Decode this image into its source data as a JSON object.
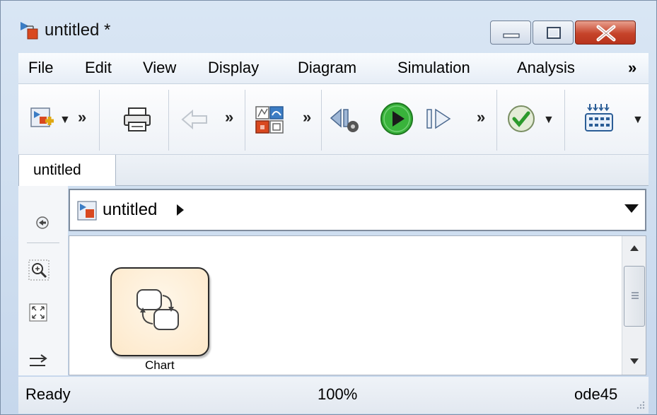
{
  "window": {
    "title": "untitled *"
  },
  "menu": [
    "File",
    "Edit",
    "View",
    "Display",
    "Diagram",
    "Simulation",
    "Analysis"
  ],
  "menu_overflow": "»",
  "toolbar": {
    "items": [
      {
        "icon": "new-model-icon"
      },
      {
        "icon": "print-icon"
      },
      {
        "icon": "back-arrow-icon"
      },
      {
        "icon": "library-browser-icon"
      },
      {
        "icon": "step-back-icon"
      },
      {
        "icon": "run-icon"
      },
      {
        "icon": "step-forward-icon"
      },
      {
        "icon": "model-advisor-check-icon"
      },
      {
        "icon": "build-icon"
      }
    ],
    "chevron": "»"
  },
  "tabs": [
    {
      "label": "untitled"
    }
  ],
  "address": {
    "model": "untitled"
  },
  "canvas": {
    "block": {
      "label": "Chart",
      "icon": "stateflow-chart-icon"
    }
  },
  "status": {
    "left": "Ready",
    "zoom": "100%",
    "solver": "ode45"
  },
  "colors": {
    "accent_green": "#2fa52f",
    "close_red": "#c6432a",
    "block_fill": "#fde8c9"
  }
}
